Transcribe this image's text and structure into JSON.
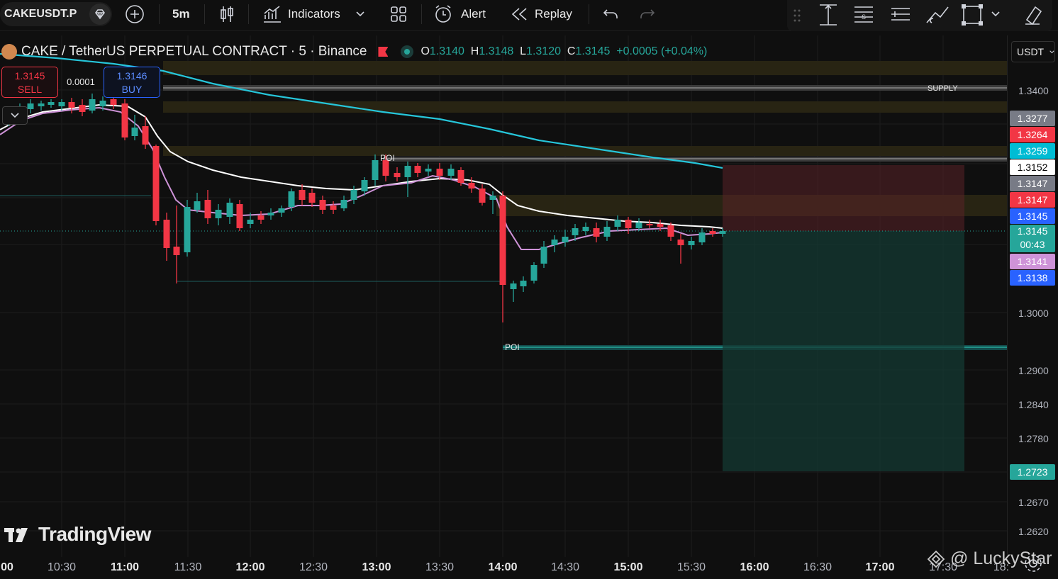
{
  "toolbar": {
    "symbol": "CAKEUSDT.P",
    "interval": "5m",
    "indicators_label": "Indicators",
    "alert_label": "Alert",
    "replay_label": "Replay"
  },
  "legend": {
    "title": "CAKE / TetherUS PERPETUAL CONTRACT · 5 · Binance",
    "o_label": "O",
    "o": "1.3140",
    "h_label": "H",
    "h": "1.3148",
    "l_label": "L",
    "l": "1.3120",
    "c_label": "C",
    "c": "1.3145",
    "change": "+0.0005 (+0.04%)"
  },
  "trade": {
    "sell_price": "1.3145",
    "sell_label": "SELL",
    "buy_price": "1.3146",
    "buy_label": "BUY",
    "spread": "0.0001"
  },
  "currency": "USDT",
  "annotations": {
    "supply": "SUPPLY",
    "poi_upper": "POI",
    "poi_lower": "POI"
  },
  "price_axis": {
    "ticks": [
      "1.3400",
      "1.3000",
      "1.2900",
      "1.2840",
      "1.2780",
      "1.2670",
      "1.2620"
    ],
    "badges": [
      {
        "value": "1.3277",
        "color": "#787b86"
      },
      {
        "value": "1.3264",
        "color": "#f23645"
      },
      {
        "value": "1.3259",
        "color": "#00bcd4"
      },
      {
        "value": "1.3152",
        "color": "#ffffff"
      },
      {
        "value": "1.3147",
        "color": "#787b86"
      },
      {
        "value": "1.3147",
        "color": "#f23645"
      },
      {
        "value": "1.3145",
        "color": "#2962ff"
      },
      {
        "value": "1.3141",
        "color": "#ce93d8"
      },
      {
        "value": "1.3138",
        "color": "#2962ff"
      },
      {
        "value": "1.2723",
        "color": "#26a69a"
      }
    ],
    "current": {
      "value": "1.3145",
      "countdown": "00:43",
      "color": "#26a69a"
    }
  },
  "time_axis": {
    "ticks": [
      "00",
      "10:30",
      "11:00",
      "11:30",
      "12:00",
      "12:30",
      "13:00",
      "13:30",
      "14:00",
      "14:30",
      "15:00",
      "15:30",
      "16:00",
      "16:30",
      "17:00",
      "17:30",
      "18:"
    ]
  },
  "branding": {
    "logo_text": "TradingView",
    "watermark": "@ LuckyStar"
  },
  "colors": {
    "up": "#26a69a",
    "down": "#f23645",
    "ema_slow": "#26c6da",
    "ema_mid": "#ffffff",
    "ema_fast": "#ce93d8"
  }
}
